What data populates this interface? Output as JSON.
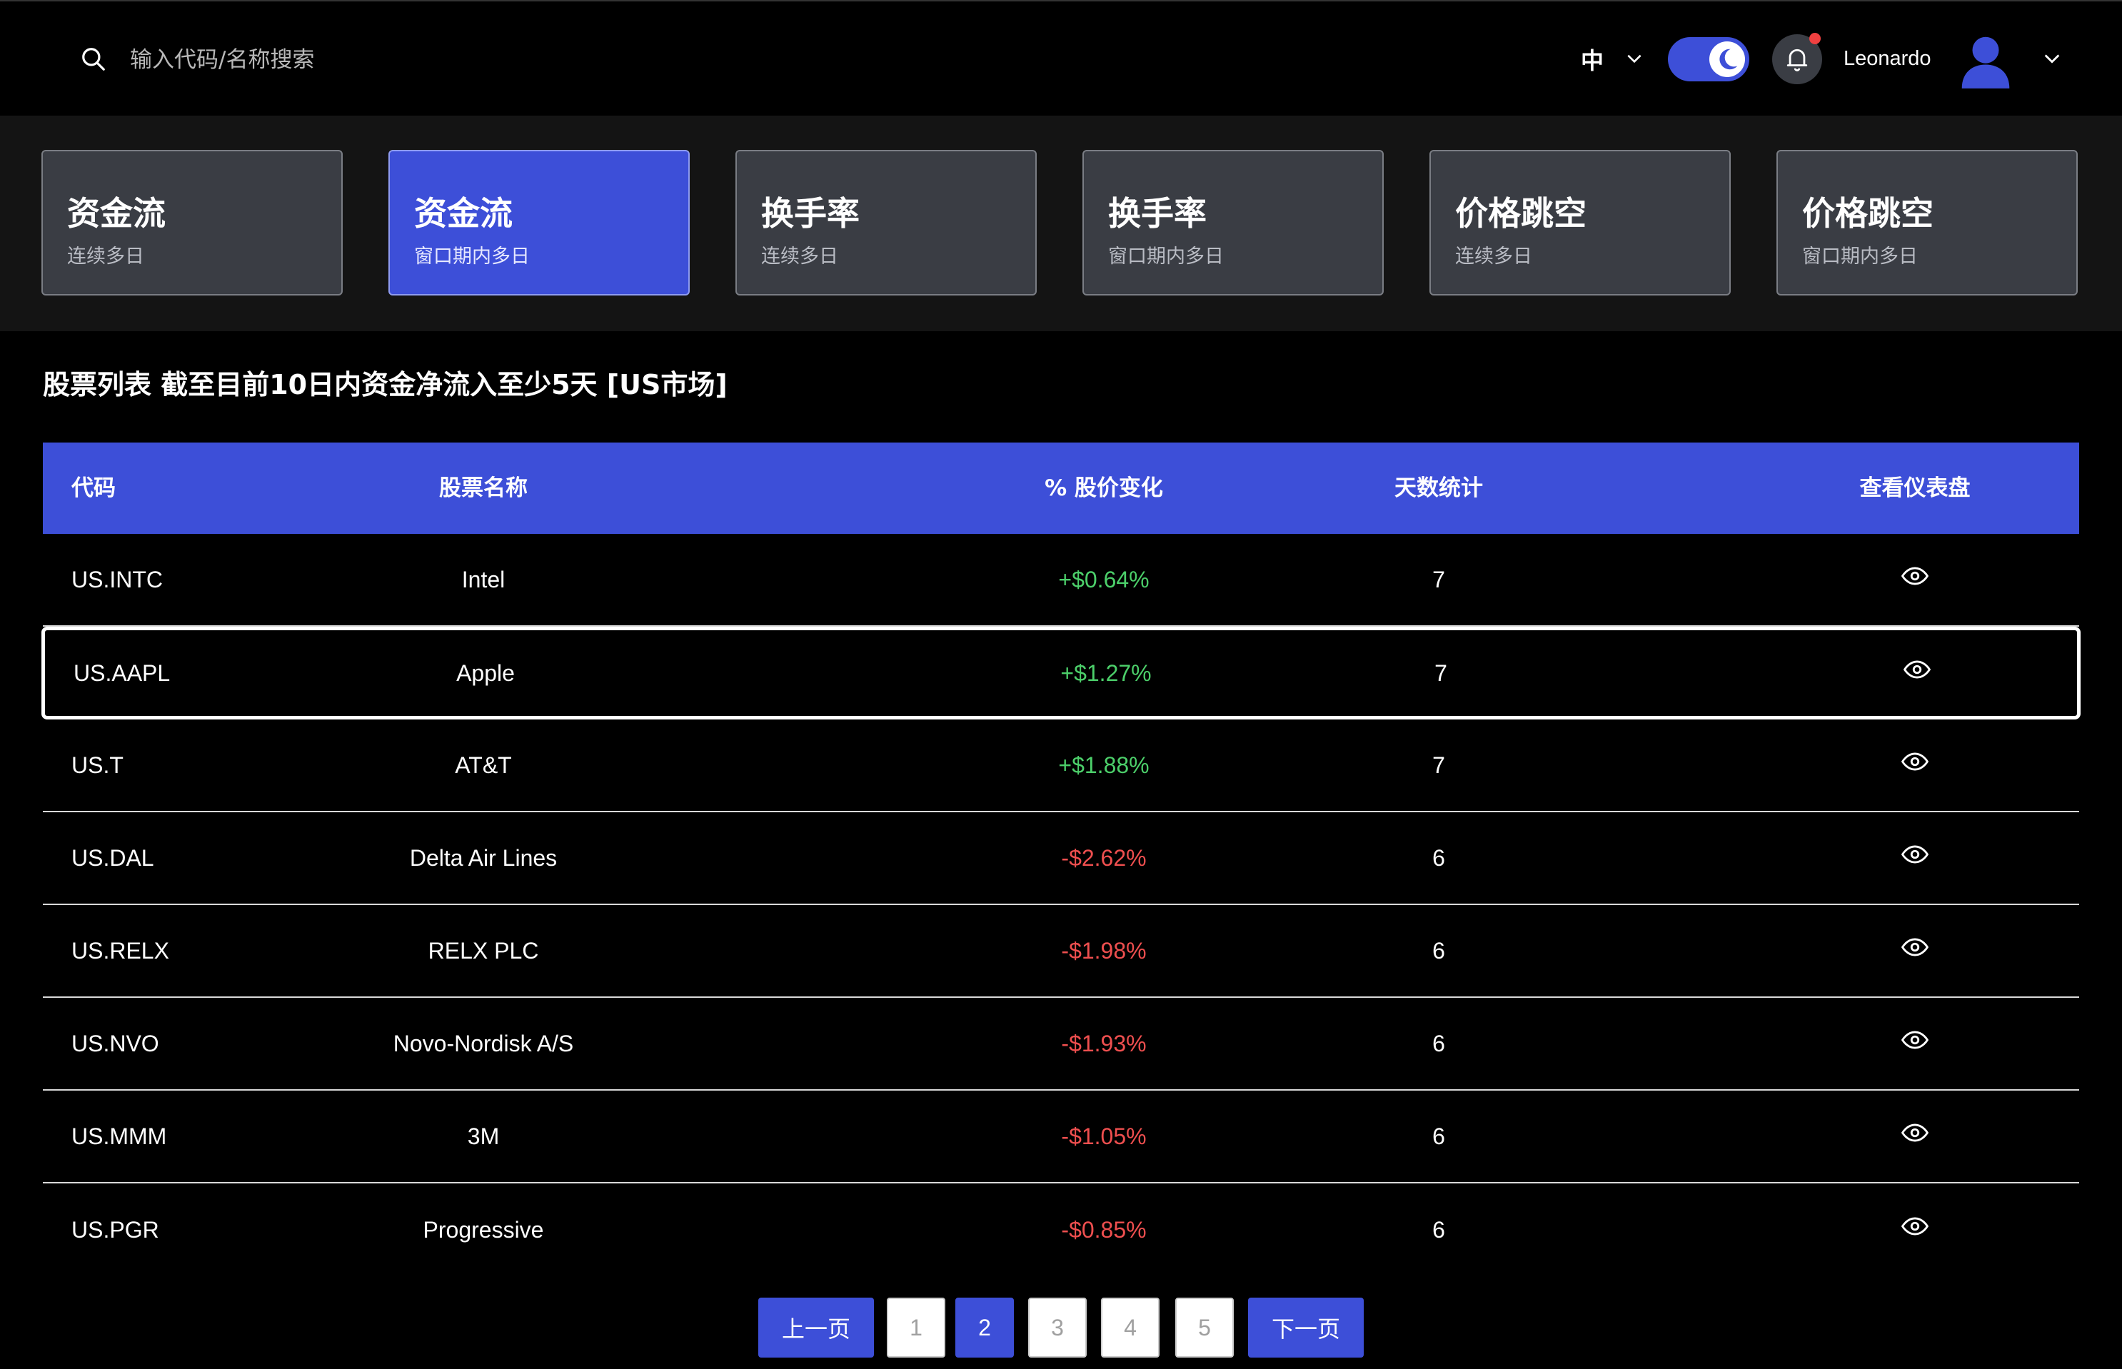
{
  "header": {
    "search_placeholder": "输入代码/名称搜索",
    "language": "中",
    "username": "Leonardo"
  },
  "cards": [
    {
      "title": "资金流",
      "subtitle": "连续多日",
      "active": false
    },
    {
      "title": "资金流",
      "subtitle": "窗口期内多日",
      "active": true
    },
    {
      "title": "换手率",
      "subtitle": "连续多日",
      "active": false
    },
    {
      "title": "换手率",
      "subtitle": "窗口期内多日",
      "active": false
    },
    {
      "title": "价格跳空",
      "subtitle": "连续多日",
      "active": false
    },
    {
      "title": "价格跳空",
      "subtitle": "窗口期内多日",
      "active": false
    }
  ],
  "list_title": "股票列表 截至目前10日内资金净流入至少5天 [US市场]",
  "table": {
    "columns": [
      "代码",
      "股票名称",
      "% 股价变化",
      "天数统计",
      "查看仪表盘"
    ],
    "rows": [
      {
        "code": "US.INTC",
        "name": "Intel",
        "change": "+$0.64%",
        "days": "7",
        "direction": "up"
      },
      {
        "code": "US.AAPL",
        "name": "Apple",
        "change": "+$1.27%",
        "days": "7",
        "direction": "up"
      },
      {
        "code": "US.T",
        "name": "AT&T",
        "change": "+$1.88%",
        "days": "7",
        "direction": "up"
      },
      {
        "code": "US.DAL",
        "name": "Delta Air Lines",
        "change": "-$2.62%",
        "days": "6",
        "direction": "down"
      },
      {
        "code": "US.RELX",
        "name": "RELX PLC",
        "change": "-$1.98%",
        "days": "6",
        "direction": "down"
      },
      {
        "code": "US.NVO",
        "name": "Novo-Nordisk A/S",
        "change": "-$1.93%",
        "days": "6",
        "direction": "down"
      },
      {
        "code": "US.MMM",
        "name": "3M",
        "change": "-$1.05%",
        "days": "6",
        "direction": "down"
      },
      {
        "code": "US.PGR",
        "name": "Progressive",
        "change": "-$0.85%",
        "days": "6",
        "direction": "down"
      }
    ],
    "selected_row": "US.AAPL"
  },
  "pagination": {
    "prev_label": "上一页",
    "next_label": "下一页",
    "pages": [
      "1",
      "2",
      "3",
      "4",
      "5"
    ],
    "current": "2"
  },
  "colors": {
    "accent": "#3d4fd8",
    "positive": "#4ccf6a",
    "negative": "#ef4f4f",
    "notification_dot": "#f04040"
  }
}
